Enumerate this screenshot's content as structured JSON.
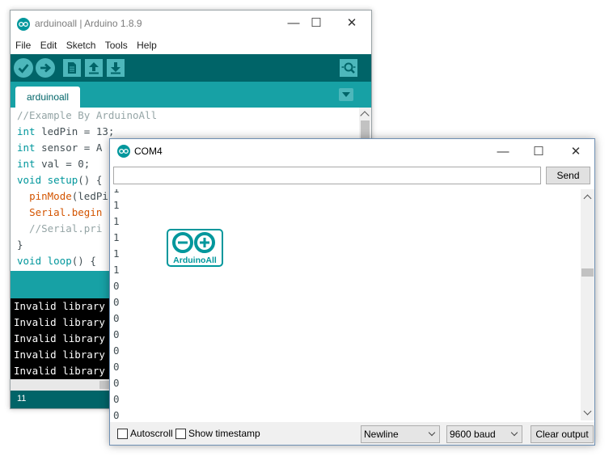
{
  "ide": {
    "title": "arduinoall | Arduino 1.8.9",
    "menu": [
      "File",
      "Edit",
      "Sketch",
      "Tools",
      "Help"
    ],
    "toolbar_icons": [
      "verify-icon",
      "upload-icon",
      "new-icon",
      "open-icon",
      "save-icon",
      "serial-monitor-icon"
    ],
    "tab_label": "arduinoall",
    "code": {
      "line1": "//Example By ArduinoAll",
      "line2_kw": "int",
      "line2_rest": " ledPin = 13;",
      "line3_kw": "int",
      "line3_rest": " sensor = A",
      "line4_kw": "int",
      "line4_rest": " val = 0;",
      "line5_kw": "void",
      "line5_fn": " setup",
      "line5_rest": "() {",
      "line6_fn": "pinMode",
      "line6_rest": "(ledPi",
      "line7_fn": "Serial",
      "line7_rest": ".begin",
      "line8": "  //Serial.pri",
      "line9": "}",
      "line10_kw": "void",
      "line10_fn": " loop",
      "line10_rest": "() {"
    },
    "console_lines": [
      "Invalid library",
      "Invalid library",
      "Invalid library",
      "Invalid library",
      "Invalid library"
    ],
    "footer_line": "11"
  },
  "serial": {
    "title": "COM4",
    "input_value": "",
    "send_label": "Send",
    "output_lines": [
      "1",
      "1",
      "1",
      "1",
      "1",
      "1",
      "0",
      "0",
      "0",
      "0",
      "0",
      "0",
      "0",
      "0",
      "0"
    ],
    "autoscroll_label": "Autoscroll",
    "timestamp_label": "Show timestamp",
    "line_ending": "Newline",
    "baud": "9600 baud",
    "clear_label": "Clear output",
    "logo_text": "ArduinoAll"
  },
  "colors": {
    "teal_dark": "#006468",
    "teal": "#17a1a5",
    "keyword": "#00979c",
    "function": "#d35400"
  }
}
